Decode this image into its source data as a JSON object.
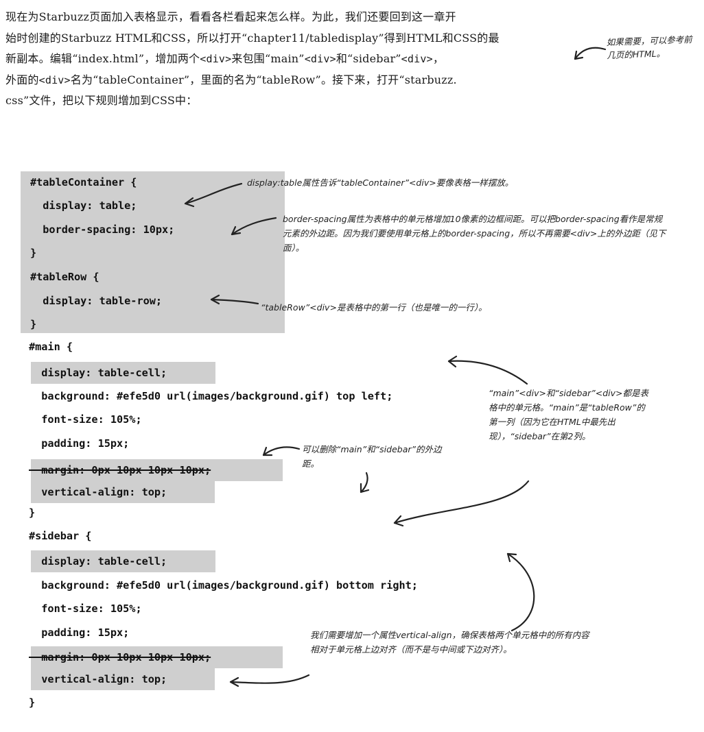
{
  "intro": {
    "line1": "现在为Starbuzz页面加入表格显示，看看各栏看起来怎么样。为此，我们还要回到这一章开",
    "line2": "始时创建的Starbuzz HTML和CSS，所以打开“chapter11/tabledisplay”得到HTML和CSS的最",
    "line3_a": "新副本。编辑“index.html”，增加两个",
    "div1": "<div>",
    "line3_b": "来包围“main”",
    "div2": "<div>",
    "line3_c": "和“sidebar”",
    "div3": "<div>",
    "line3_d": "，",
    "line4_a": "外面的",
    "div4": "<div>",
    "line4_b": "名为“tableContainer”，里面的名为“tableRow”。接下来，打开“starbuzz.",
    "line5": "css”文件，把以下规则增加到CSS中："
  },
  "side_note": "如果需要，可以参考前几页的HTML。",
  "code": [
    "#tableContainer {",
    "  display: table;",
    "  border-spacing: 10px;",
    "}",
    "#tableRow {",
    "  display: table-row;",
    "}",
    "#main {",
    "  display: table-cell;",
    "  background: #efe5d0 url(images/background.gif) top left;",
    "  font-size: 105%;",
    "  padding: 15px;",
    "  margin: 0px 10px 10px 10px;",
    "  vertical-align: top;",
    "}",
    "#sidebar {",
    "  display: table-cell;",
    "  background: #efe5d0 url(images/background.gif) bottom right;",
    "  font-size: 105%;",
    "  padding: 15px;",
    "  margin: 0px 10px 10px 10px;",
    "  vertical-align: top;",
    "}"
  ],
  "notes": {
    "display_table": "display:table属性告诉“tableContainer”<div>要像表格一样摆放。",
    "border_spacing": "border-spacing属性为表格中的单元格增加10像素的边框间距。可以把border-spacing看作是常规元素的外边距。因为我们要使用单元格上的border-spacing，所以不再需要<div>上的外边距（见下面）。",
    "table_row": "“tableRow”<div>是表格中的第一行（也是唯一的一行）。",
    "cells": "“main”<div>和“sidebar”<div>都是表格中的单元格。“main”是“tableRow”的第一列（因为它在HTML中最先出现），“sidebar”在第2列。",
    "remove_margin": "可以删除“main”和“sidebar”的外边距。",
    "vertical_align": "我们需要增加一个属性vertical-align，确保表格两个单元格中的所有内容相对于单元格上边对齐（而不是与中间或下边对齐）。"
  },
  "colors": {
    "highlight": "#cfcfcf",
    "text": "#1a1a1a"
  }
}
